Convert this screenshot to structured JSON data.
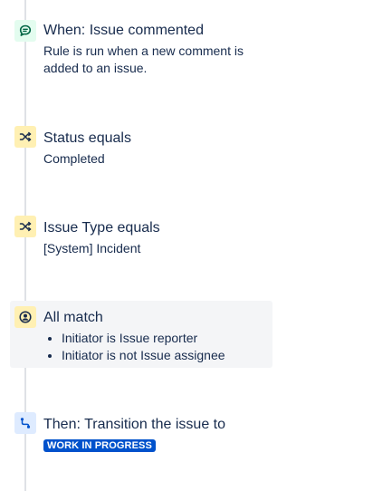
{
  "colors": {
    "trigger_icon_bg": "#e3fcef",
    "trigger_icon_fg": "#006644",
    "condition_icon_bg": "#fff0b3",
    "condition_icon_fg": "#172b4d",
    "action_icon_bg": "#deebff",
    "action_icon_fg": "#0052cc",
    "lozenge_bg": "#0052cc",
    "group_bg": "#f4f5f7"
  },
  "trigger": {
    "icon": "comment-icon",
    "title": "When: Issue commented",
    "description": "Rule is run when a new comment is added to an issue."
  },
  "conditions": [
    {
      "icon": "shuffle-icon",
      "title": "Status equals",
      "value": "Completed"
    },
    {
      "icon": "shuffle-icon",
      "title": "Issue Type equals",
      "value": "[System] Incident"
    }
  ],
  "group": {
    "icon": "user-circle-icon",
    "title": "All match",
    "items": [
      "Initiator is Issue reporter",
      "Initiator is not Issue assignee"
    ]
  },
  "action": {
    "icon": "transition-icon",
    "title": "Then: Transition the issue to",
    "status": "WORK IN PROGRESS"
  }
}
